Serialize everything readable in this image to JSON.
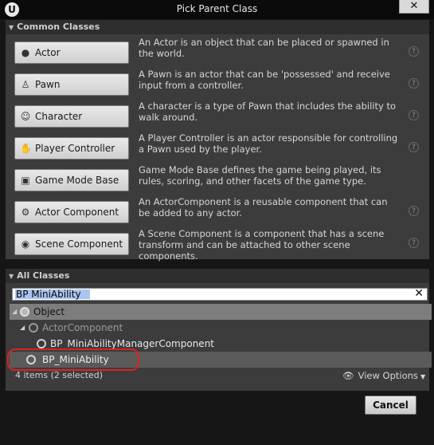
{
  "window": {
    "title": "Pick Parent Class",
    "logo_glyph": "U",
    "close_glyph": "✕"
  },
  "common": {
    "header": "Common Classes",
    "items": [
      {
        "label": "Actor",
        "icon": "actor-icon",
        "glyph": "●",
        "description": "An Actor is an object that can be placed or spawned in the world."
      },
      {
        "label": "Pawn",
        "icon": "pawn-icon",
        "glyph": "♙",
        "description": "A Pawn is an actor that can be 'possessed' and receive input from a controller."
      },
      {
        "label": "Character",
        "icon": "character-icon",
        "glyph": "☺",
        "description": "A character is a type of Pawn that includes the ability to walk around."
      },
      {
        "label": "Player Controller",
        "icon": "player-controller-icon",
        "glyph": "✋",
        "description": "A Player Controller is an actor responsible for controlling a Pawn used by the player."
      },
      {
        "label": "Game Mode Base",
        "icon": "game-mode-icon",
        "glyph": "▣",
        "description": "Game Mode Base defines the game being played, its rules, scoring, and other facets of the game type."
      },
      {
        "label": "Actor Component",
        "icon": "actor-component-icon",
        "glyph": "⚙",
        "description": "An ActorComponent is a reusable component that can be added to any actor."
      },
      {
        "label": "Scene Component",
        "icon": "scene-component-icon",
        "glyph": "◉",
        "description": "A Scene Component is a component that has a scene transform and can be attached to other scene components."
      }
    ],
    "help_glyph": "?"
  },
  "all": {
    "header": "All Classes",
    "search_value": "BP MiniAbility",
    "clear_glyph": "✕",
    "tree": {
      "object": "Object",
      "actor_component": "ActorComponent",
      "manager": "BP_MiniAbilityManagerComponent",
      "mini": "BP_MiniAbility"
    },
    "count": "4 items (2 selected)",
    "view_options": "View Options",
    "eye_glyph": "👁",
    "caret_glyph": "▼"
  },
  "footer": {
    "cancel": "Cancel"
  },
  "colors": {
    "panel": "#3c3c3c",
    "selected_row": "#7d7d7d",
    "annotation": "#e02020"
  }
}
